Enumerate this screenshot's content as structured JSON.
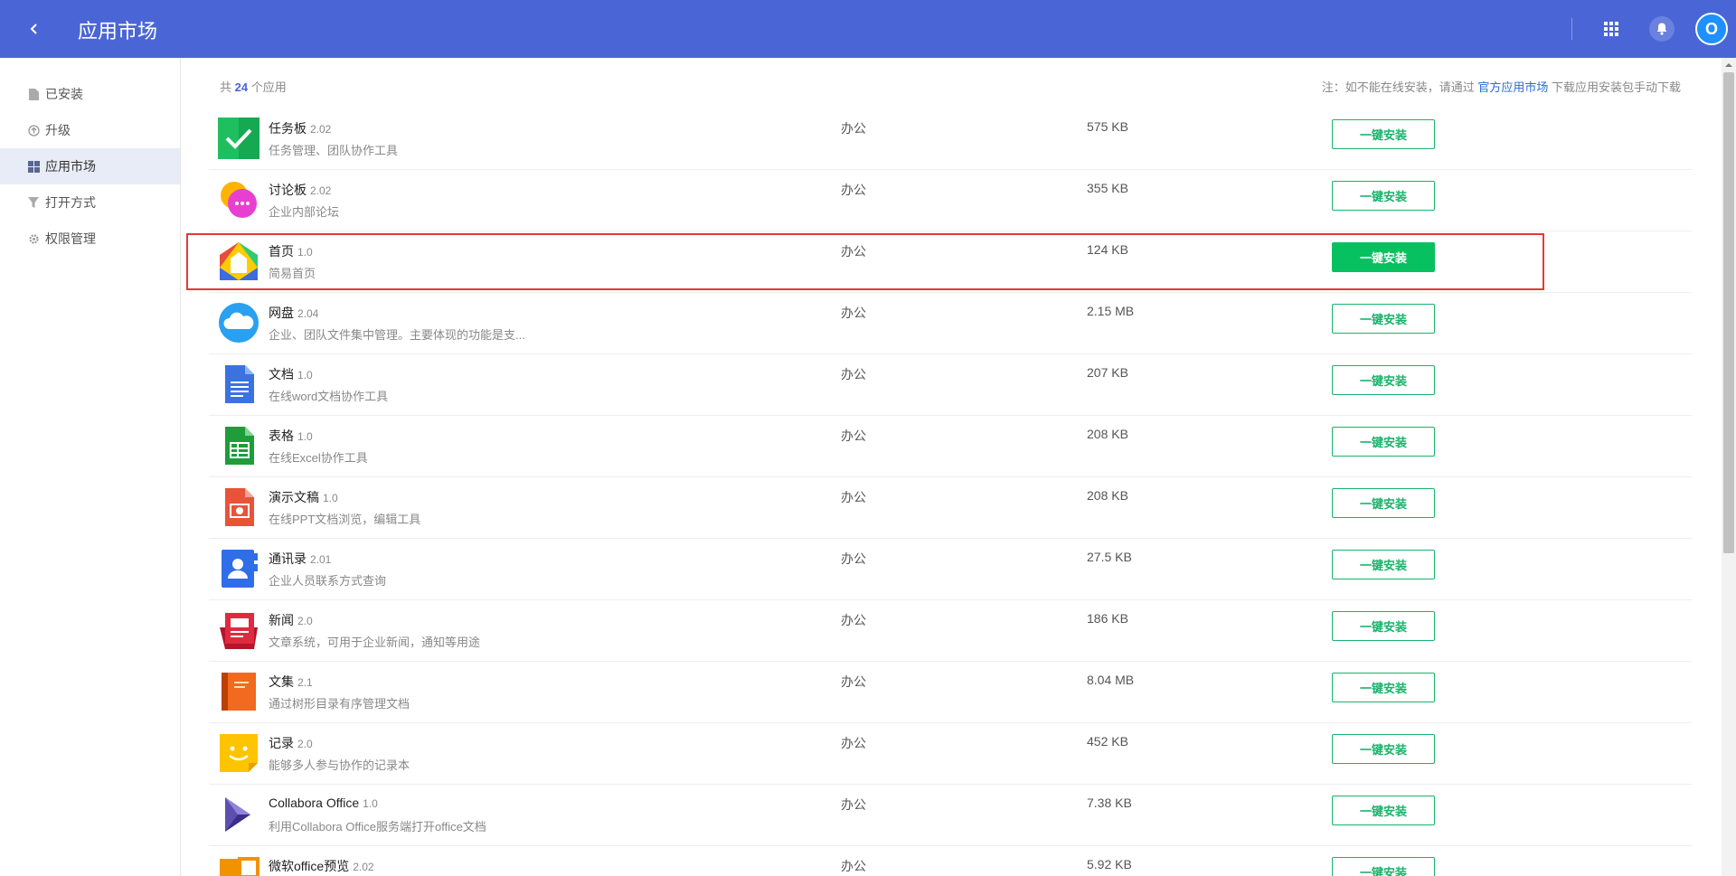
{
  "header": {
    "title": "应用市场",
    "avatar_letter": "O"
  },
  "colors": {
    "header_bg": "#4a66d6",
    "install_green": "#19b36b",
    "install_primary": "#07c160",
    "highlight_red": "#e53935"
  },
  "sidebar": {
    "items": [
      {
        "label": "已安装",
        "icon": "file-icon"
      },
      {
        "label": "升级",
        "icon": "upgrade-icon"
      },
      {
        "label": "应用市场",
        "icon": "grid-icon",
        "active": true
      },
      {
        "label": "打开方式",
        "icon": "filter-icon"
      },
      {
        "label": "权限管理",
        "icon": "gear-icon"
      }
    ]
  },
  "summary": {
    "prefix": "共",
    "count": "24",
    "suffix": "个应用"
  },
  "note": {
    "prefix": "注：如不能在线安装，请通过",
    "link": "官方应用市场",
    "suffix": "下载应用安装包手动下载"
  },
  "apps": [
    {
      "name": "任务板",
      "version": "2.02",
      "desc": "任务管理、团队协作工具",
      "category": "办公",
      "size": "575 KB",
      "icon": "taskboard-icon",
      "button": "一键安装"
    },
    {
      "name": "讨论板",
      "version": "2.02",
      "desc": "企业内部论坛",
      "category": "办公",
      "size": "355 KB",
      "icon": "discussion-icon",
      "button": "一键安装"
    },
    {
      "name": "首页",
      "version": "1.0",
      "desc": "简易首页",
      "category": "办公",
      "size": "124 KB",
      "icon": "home-icon",
      "button": "一键安装",
      "highlight": true
    },
    {
      "name": "网盘",
      "version": "2.04",
      "desc": "企业、团队文件集中管理。主要体现的功能是支...",
      "category": "办公",
      "size": "2.15 MB",
      "icon": "cloud-icon",
      "button": "一键安装"
    },
    {
      "name": "文档",
      "version": "1.0",
      "desc": "在线word文档协作工具",
      "category": "办公",
      "size": "207 KB",
      "icon": "document-icon",
      "button": "一键安装"
    },
    {
      "name": "表格",
      "version": "1.0",
      "desc": "在线Excel协作工具",
      "category": "办公",
      "size": "208 KB",
      "icon": "spreadsheet-icon",
      "button": "一键安装"
    },
    {
      "name": "演示文稿",
      "version": "1.0",
      "desc": "在线PPT文档浏览，编辑工具",
      "category": "办公",
      "size": "208 KB",
      "icon": "presentation-icon",
      "button": "一键安装"
    },
    {
      "name": "通讯录",
      "version": "2.01",
      "desc": "企业人员联系方式查询",
      "category": "办公",
      "size": "27.5 KB",
      "icon": "contacts-icon",
      "button": "一键安装"
    },
    {
      "name": "新闻",
      "version": "2.0",
      "desc": "文章系统，可用于企业新闻，通知等用途",
      "category": "办公",
      "size": "186 KB",
      "icon": "news-icon",
      "button": "一键安装"
    },
    {
      "name": "文集",
      "version": "2.1",
      "desc": "通过树形目录有序管理文档",
      "category": "办公",
      "size": "8.04 MB",
      "icon": "book-icon",
      "button": "一键安装"
    },
    {
      "name": "记录",
      "version": "2.0",
      "desc": "能够多人参与协作的记录本",
      "category": "办公",
      "size": "452 KB",
      "icon": "notes-icon",
      "button": "一键安装"
    },
    {
      "name": "Collabora Office",
      "version": "1.0",
      "desc": "利用Collabora Office服务端打开office文档",
      "category": "办公",
      "size": "7.38 KB",
      "icon": "collabora-icon",
      "button": "一键安装"
    },
    {
      "name": "微软office预览",
      "version": "2.02",
      "desc": "",
      "category": "办公",
      "size": "5.92 KB",
      "icon": "msoffice-icon",
      "button": "一键安装"
    }
  ]
}
